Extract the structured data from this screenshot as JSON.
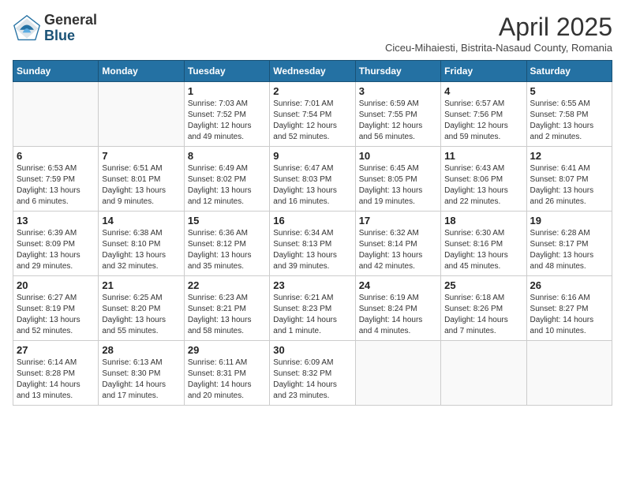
{
  "header": {
    "logo_general": "General",
    "logo_blue": "Blue",
    "month_title": "April 2025",
    "subtitle": "Ciceu-Mihaiesti, Bistrita-Nasaud County, Romania"
  },
  "weekdays": [
    "Sunday",
    "Monday",
    "Tuesday",
    "Wednesday",
    "Thursday",
    "Friday",
    "Saturday"
  ],
  "weeks": [
    [
      {
        "day": "",
        "info": ""
      },
      {
        "day": "",
        "info": ""
      },
      {
        "day": "1",
        "info": "Sunrise: 7:03 AM\nSunset: 7:52 PM\nDaylight: 12 hours and 49 minutes."
      },
      {
        "day": "2",
        "info": "Sunrise: 7:01 AM\nSunset: 7:54 PM\nDaylight: 12 hours and 52 minutes."
      },
      {
        "day": "3",
        "info": "Sunrise: 6:59 AM\nSunset: 7:55 PM\nDaylight: 12 hours and 56 minutes."
      },
      {
        "day": "4",
        "info": "Sunrise: 6:57 AM\nSunset: 7:56 PM\nDaylight: 12 hours and 59 minutes."
      },
      {
        "day": "5",
        "info": "Sunrise: 6:55 AM\nSunset: 7:58 PM\nDaylight: 13 hours and 2 minutes."
      }
    ],
    [
      {
        "day": "6",
        "info": "Sunrise: 6:53 AM\nSunset: 7:59 PM\nDaylight: 13 hours and 6 minutes."
      },
      {
        "day": "7",
        "info": "Sunrise: 6:51 AM\nSunset: 8:01 PM\nDaylight: 13 hours and 9 minutes."
      },
      {
        "day": "8",
        "info": "Sunrise: 6:49 AM\nSunset: 8:02 PM\nDaylight: 13 hours and 12 minutes."
      },
      {
        "day": "9",
        "info": "Sunrise: 6:47 AM\nSunset: 8:03 PM\nDaylight: 13 hours and 16 minutes."
      },
      {
        "day": "10",
        "info": "Sunrise: 6:45 AM\nSunset: 8:05 PM\nDaylight: 13 hours and 19 minutes."
      },
      {
        "day": "11",
        "info": "Sunrise: 6:43 AM\nSunset: 8:06 PM\nDaylight: 13 hours and 22 minutes."
      },
      {
        "day": "12",
        "info": "Sunrise: 6:41 AM\nSunset: 8:07 PM\nDaylight: 13 hours and 26 minutes."
      }
    ],
    [
      {
        "day": "13",
        "info": "Sunrise: 6:39 AM\nSunset: 8:09 PM\nDaylight: 13 hours and 29 minutes."
      },
      {
        "day": "14",
        "info": "Sunrise: 6:38 AM\nSunset: 8:10 PM\nDaylight: 13 hours and 32 minutes."
      },
      {
        "day": "15",
        "info": "Sunrise: 6:36 AM\nSunset: 8:12 PM\nDaylight: 13 hours and 35 minutes."
      },
      {
        "day": "16",
        "info": "Sunrise: 6:34 AM\nSunset: 8:13 PM\nDaylight: 13 hours and 39 minutes."
      },
      {
        "day": "17",
        "info": "Sunrise: 6:32 AM\nSunset: 8:14 PM\nDaylight: 13 hours and 42 minutes."
      },
      {
        "day": "18",
        "info": "Sunrise: 6:30 AM\nSunset: 8:16 PM\nDaylight: 13 hours and 45 minutes."
      },
      {
        "day": "19",
        "info": "Sunrise: 6:28 AM\nSunset: 8:17 PM\nDaylight: 13 hours and 48 minutes."
      }
    ],
    [
      {
        "day": "20",
        "info": "Sunrise: 6:27 AM\nSunset: 8:19 PM\nDaylight: 13 hours and 52 minutes."
      },
      {
        "day": "21",
        "info": "Sunrise: 6:25 AM\nSunset: 8:20 PM\nDaylight: 13 hours and 55 minutes."
      },
      {
        "day": "22",
        "info": "Sunrise: 6:23 AM\nSunset: 8:21 PM\nDaylight: 13 hours and 58 minutes."
      },
      {
        "day": "23",
        "info": "Sunrise: 6:21 AM\nSunset: 8:23 PM\nDaylight: 14 hours and 1 minute."
      },
      {
        "day": "24",
        "info": "Sunrise: 6:19 AM\nSunset: 8:24 PM\nDaylight: 14 hours and 4 minutes."
      },
      {
        "day": "25",
        "info": "Sunrise: 6:18 AM\nSunset: 8:26 PM\nDaylight: 14 hours and 7 minutes."
      },
      {
        "day": "26",
        "info": "Sunrise: 6:16 AM\nSunset: 8:27 PM\nDaylight: 14 hours and 10 minutes."
      }
    ],
    [
      {
        "day": "27",
        "info": "Sunrise: 6:14 AM\nSunset: 8:28 PM\nDaylight: 14 hours and 13 minutes."
      },
      {
        "day": "28",
        "info": "Sunrise: 6:13 AM\nSunset: 8:30 PM\nDaylight: 14 hours and 17 minutes."
      },
      {
        "day": "29",
        "info": "Sunrise: 6:11 AM\nSunset: 8:31 PM\nDaylight: 14 hours and 20 minutes."
      },
      {
        "day": "30",
        "info": "Sunrise: 6:09 AM\nSunset: 8:32 PM\nDaylight: 14 hours and 23 minutes."
      },
      {
        "day": "",
        "info": ""
      },
      {
        "day": "",
        "info": ""
      },
      {
        "day": "",
        "info": ""
      }
    ]
  ]
}
